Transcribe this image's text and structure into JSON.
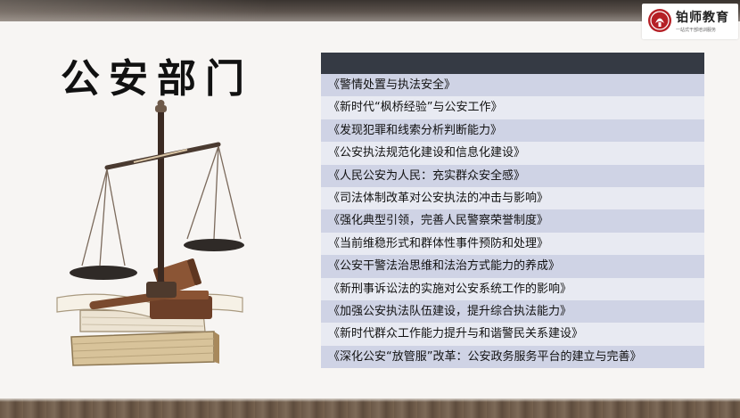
{
  "title": "公安部门",
  "logo": {
    "name": "铂师教育",
    "subtitle": "一站式干部培训服务",
    "icon": "bosi-seal-icon"
  },
  "colors": {
    "list_header": "#353a44",
    "row_odd": "#cfd3e5",
    "row_even": "#e8eaf2",
    "logo_red": "#b51f25"
  },
  "illustration": "scales-of-justice-gavel-books",
  "courses": [
    "《警情处置与执法安全》",
    "《新时代“枫桥经验”与公安工作》",
    "《发现犯罪和线索分析判断能力》",
    "《公安执法规范化建设和信息化建设》",
    "《人民公安为人民：充实群众安全感》",
    "《司法体制改革对公安执法的冲击与影响》",
    "《强化典型引领，完善人民警察荣誉制度》",
    "《当前维稳形式和群体性事件预防和处理》",
    "《公安干警法治思维和法治方式能力的养成》",
    "《新刑事诉讼法的实施对公安系统工作的影响》",
    "《加强公安执法队伍建设，提升综合执法能力》",
    "《新时代群众工作能力提升与和谐警民关系建设》",
    "《深化公安“放管服”改革：公安政务服务平台的建立与完善》"
  ]
}
